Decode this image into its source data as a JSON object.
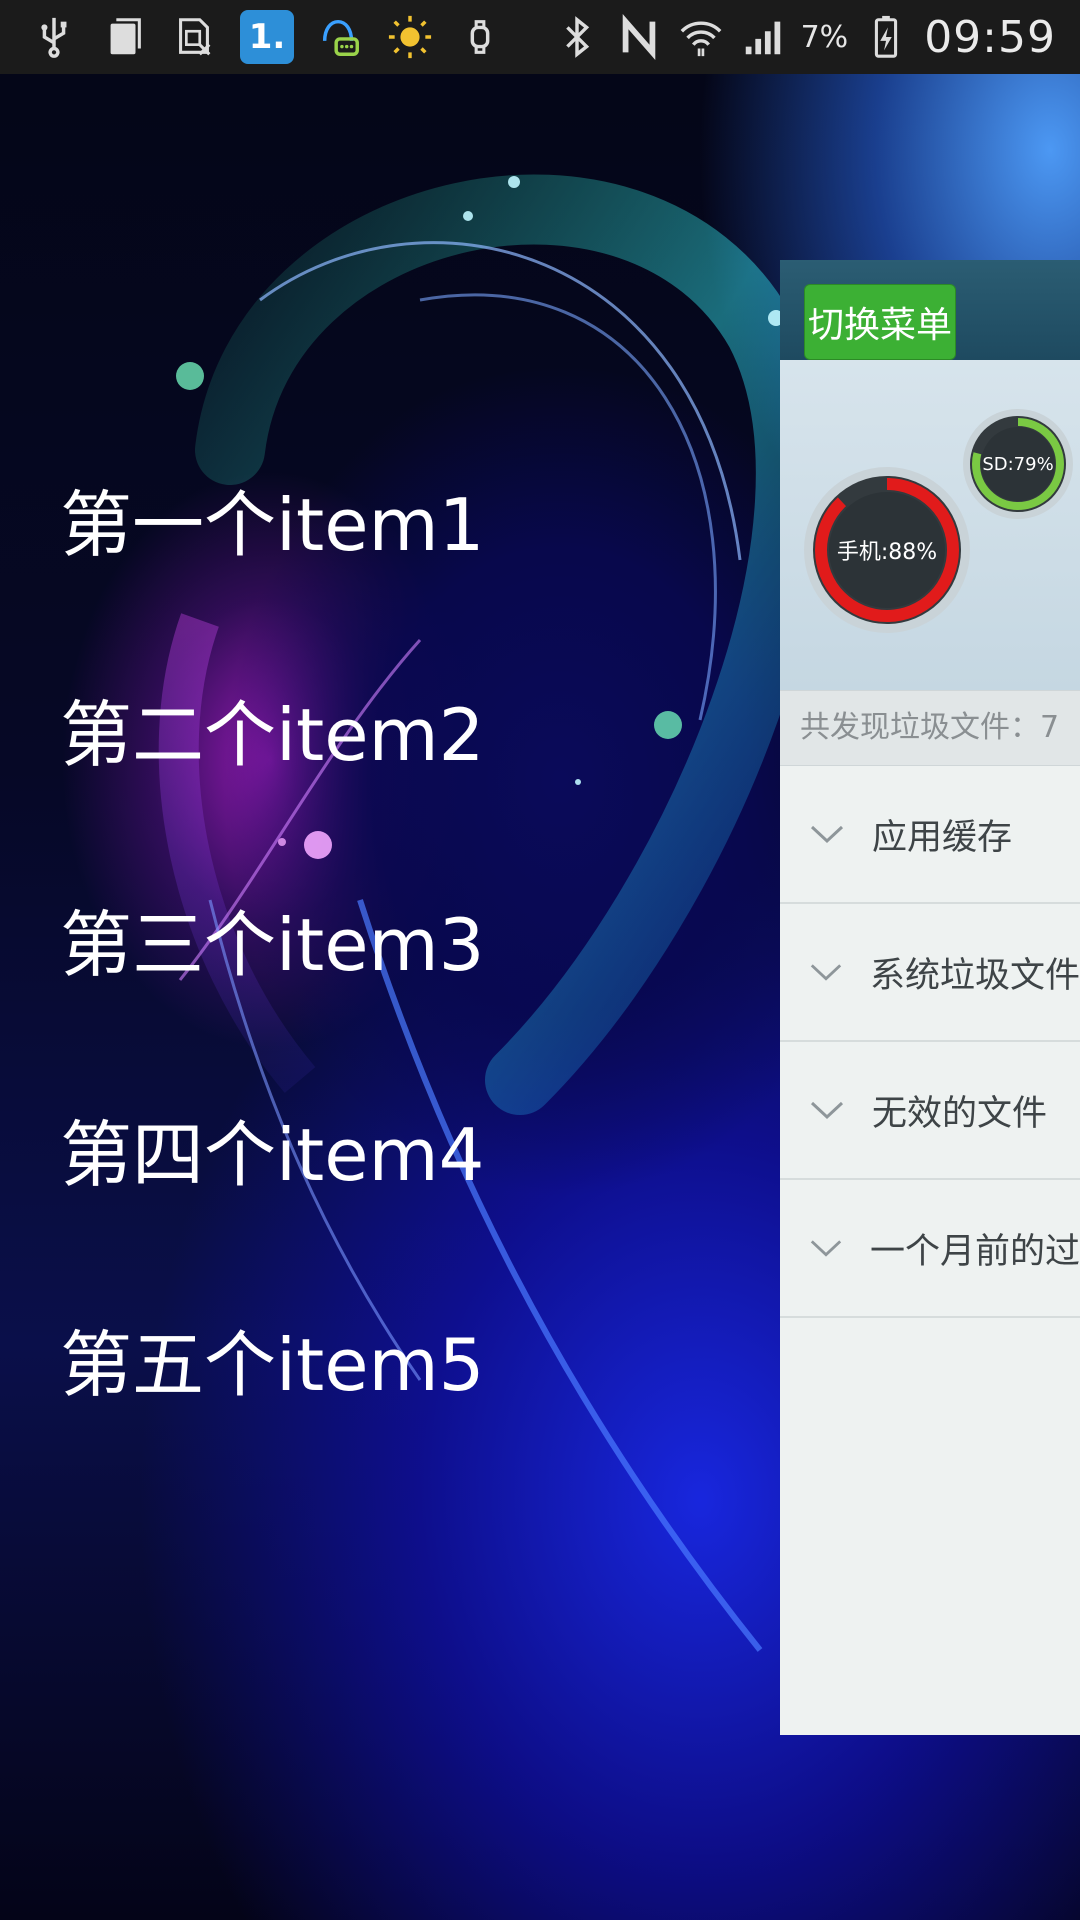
{
  "status_bar": {
    "icons": [
      "usb-icon",
      "clipboard-icon",
      "sim-off-icon",
      "badge-1-icon",
      "chat-bubble-icon",
      "sun-icon",
      "watch-icon",
      "bluetooth-icon",
      "nfc-icon",
      "wifi-icon",
      "signal-icon",
      "battery-charging-icon"
    ],
    "badge_text": "1.",
    "battery_percent": "7%",
    "time": "09:59"
  },
  "menu": {
    "items": [
      {
        "label": "第一个item1"
      },
      {
        "label": "第二个item2"
      },
      {
        "label": "第三个item3"
      },
      {
        "label": "第四个item4"
      },
      {
        "label": "第五个item5"
      }
    ]
  },
  "panel": {
    "toggle_button_label": "切换菜单",
    "gauges": {
      "phone": {
        "label": "手机:88%",
        "value": 0.88,
        "color": "#e11b1b"
      },
      "sd": {
        "label": "SD:79%",
        "value": 0.79,
        "color": "#7ac943"
      }
    },
    "summary_text": "共发现垃圾文件：7",
    "categories": [
      {
        "label": "应用缓存"
      },
      {
        "label": "系统垃圾文件"
      },
      {
        "label": "无效的文件"
      },
      {
        "label": "一个月前的过"
      }
    ]
  },
  "colors": {
    "accent_green": "#3cb034",
    "header_blue": "#1e4a60",
    "panel_bg": "#eef2f1"
  }
}
